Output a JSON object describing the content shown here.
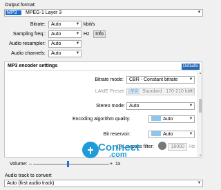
{
  "output_format": {
    "label": "Output format:",
    "selected_short": "MP3",
    "selected_desc": "MPEG-1 Layer 3"
  },
  "basic": {
    "bitrate_label": "Bitrate:",
    "bitrate_value": "Auto",
    "bitrate_unit": "kbit/s",
    "sampling_label": "Sampling freq.:",
    "sampling_value": "Auto",
    "sampling_unit": "Hz",
    "info_button": "Info",
    "resampler_label": "Audio resampler:",
    "resampler_value": "Auto",
    "channels_label": "Audio channels:",
    "channels_value": "Auto"
  },
  "encoder": {
    "title": "MP3 encoder settings",
    "defaults_button": "Defaults",
    "bitrate_mode_label": "Bitrate mode:",
    "bitrate_mode_value": "CBR - Constant bitrate",
    "lame_preset_label": "LAME Preset:",
    "lame_preset_value": "-V 2",
    "lame_preset_desc": "Standard : 170-210 kbit/s",
    "stereo_mode_label": "Stereo mode:",
    "stereo_mode_value": "Auto",
    "quality_label": "Encoding algorithm quality:",
    "quality_value": "Auto",
    "reservoir_label": "Bit reservoir:",
    "reservoir_value": "Auto",
    "lowpass_label": "Lowpass filter:",
    "lowpass_value": "16000",
    "lowpass_unit": "Hz"
  },
  "volume": {
    "label": "Volume:",
    "minus": "–",
    "plus": "+",
    "multiplier": "1x",
    "level": 0.45
  },
  "audio_track": {
    "label": "Audio track to convert",
    "value": "Auto (first audio track)"
  },
  "watermark": {
    "main": "Connect",
    "sub": ".com"
  },
  "colors": {
    "accent": "#1e74d2",
    "swatch": "#8ec6ee",
    "defaults_bg": "#2a69b3",
    "watermark": "#1f9bd9"
  }
}
